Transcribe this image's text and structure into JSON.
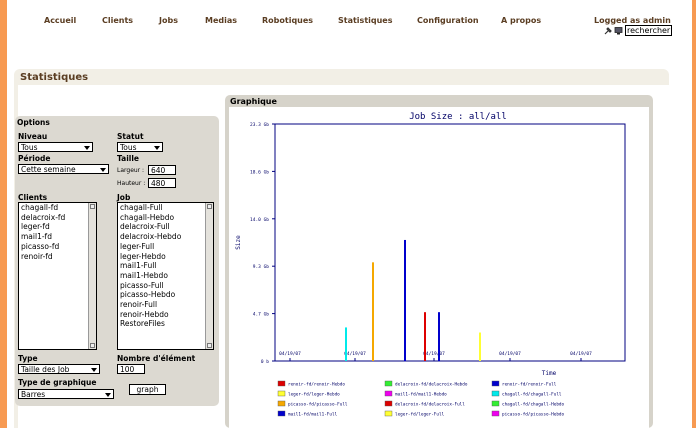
{
  "nav": {
    "items": [
      "Accueil",
      "Clients",
      "Jobs",
      "Medias",
      "Robotiques",
      "Statistiques",
      "Configuration",
      "A propos"
    ],
    "logged_in": "Logged as admin",
    "search_label": "rechercher"
  },
  "panel": {
    "title": "Statistiques"
  },
  "options": {
    "title": "Options",
    "niveau_label": "Niveau",
    "niveau_value": "Tous",
    "statut_label": "Statut",
    "statut_value": "Tous",
    "periode_label": "Période",
    "periode_value": "Cette semaine",
    "taille_label": "Taille",
    "largeur_label": "Largeur :",
    "largeur_value": "640",
    "hauteur_label": "Hauteur :",
    "hauteur_value": "480",
    "clients_label": "Clients",
    "clients": [
      "chagall-fd",
      "delacroix-fd",
      "leger-fd",
      "mail1-fd",
      "picasso-fd",
      "renoir-fd"
    ],
    "job_label": "Job",
    "jobs": [
      "chagall-Full",
      "chagall-Hebdo",
      "delacroix-Full",
      "delacroix-Hebdo",
      "leger-Full",
      "leger-Hebdo",
      "mail1-Full",
      "mail1-Hebdo",
      "picasso-Full",
      "picasso-Hebdo",
      "renoir-Full",
      "renoir-Hebdo",
      "RestoreFiles"
    ],
    "type_label": "Type",
    "type_value": "Taille des Job",
    "nombre_label": "Nombre d'élément",
    "nombre_value": "100",
    "graph_type_label": "Type de graphique",
    "graph_type_value": "Barres",
    "graph_button": "graph"
  },
  "graph_panel": {
    "title": "Graphique"
  },
  "chart_data": {
    "type": "bar",
    "title": "Job Size : all/all",
    "xlabel": "Time",
    "ylabel": "Size",
    "yticks": [
      "0 b",
      "4.7 Gb",
      "9.3 Gb",
      "14.0 Gb",
      "18.6 Gb",
      "23.3 Gb"
    ],
    "ylim": [
      0,
      23.3
    ],
    "xticks": [
      "04/19/07",
      "04/19/07",
      "04/19/07",
      "04/19/07",
      "04/19/07"
    ],
    "bars": [
      {
        "series": "chagall-fd/chagall-Full",
        "value": 3.3,
        "color": "#00eaea"
      },
      {
        "series": "picasso-fd/picasso-Full",
        "value": 9.7,
        "color": "#f5a800"
      },
      {
        "series": "mail1-fd/mail1-Full",
        "value": 11.9,
        "color": "#0000cc"
      },
      {
        "series": "delacroix-fd/delacroix-Full",
        "value": 4.8,
        "color": "#dd0000"
      },
      {
        "series": "renoir-fd/renoir-Full",
        "value": 4.8,
        "color": "#0000cc"
      },
      {
        "series": "leger-fd/leger-Full",
        "value": 2.8,
        "color": "#ffff33"
      }
    ],
    "legend": [
      {
        "name": "renoir-fd/renoir-Hebdo",
        "color": "#dd0000"
      },
      {
        "name": "delacroix-fd/delacroix-Hebdo",
        "color": "#33ee33"
      },
      {
        "name": "renoir-fd/renoir-Full",
        "color": "#0000cc"
      },
      {
        "name": "leger-fd/leger-Hebdo",
        "color": "#ffff33"
      },
      {
        "name": "mail1-fd/mail1-Hebdo",
        "color": "#ee00ee"
      },
      {
        "name": "chagall-fd/chagall-Full",
        "color": "#00eaea"
      },
      {
        "name": "picasso-fd/picasso-Full",
        "color": "#f5a800"
      },
      {
        "name": "delacroix-fd/delacroix-Full",
        "color": "#dd0000"
      },
      {
        "name": "chagall-fd/chagall-Hebdo",
        "color": "#33ee33"
      },
      {
        "name": "mail1-fd/mail1-Full",
        "color": "#0000cc"
      },
      {
        "name": "leger-fd/leger-Full",
        "color": "#ffff33"
      },
      {
        "name": "picasso-fd/picasso-Hebdo",
        "color": "#ee00ee"
      }
    ]
  }
}
